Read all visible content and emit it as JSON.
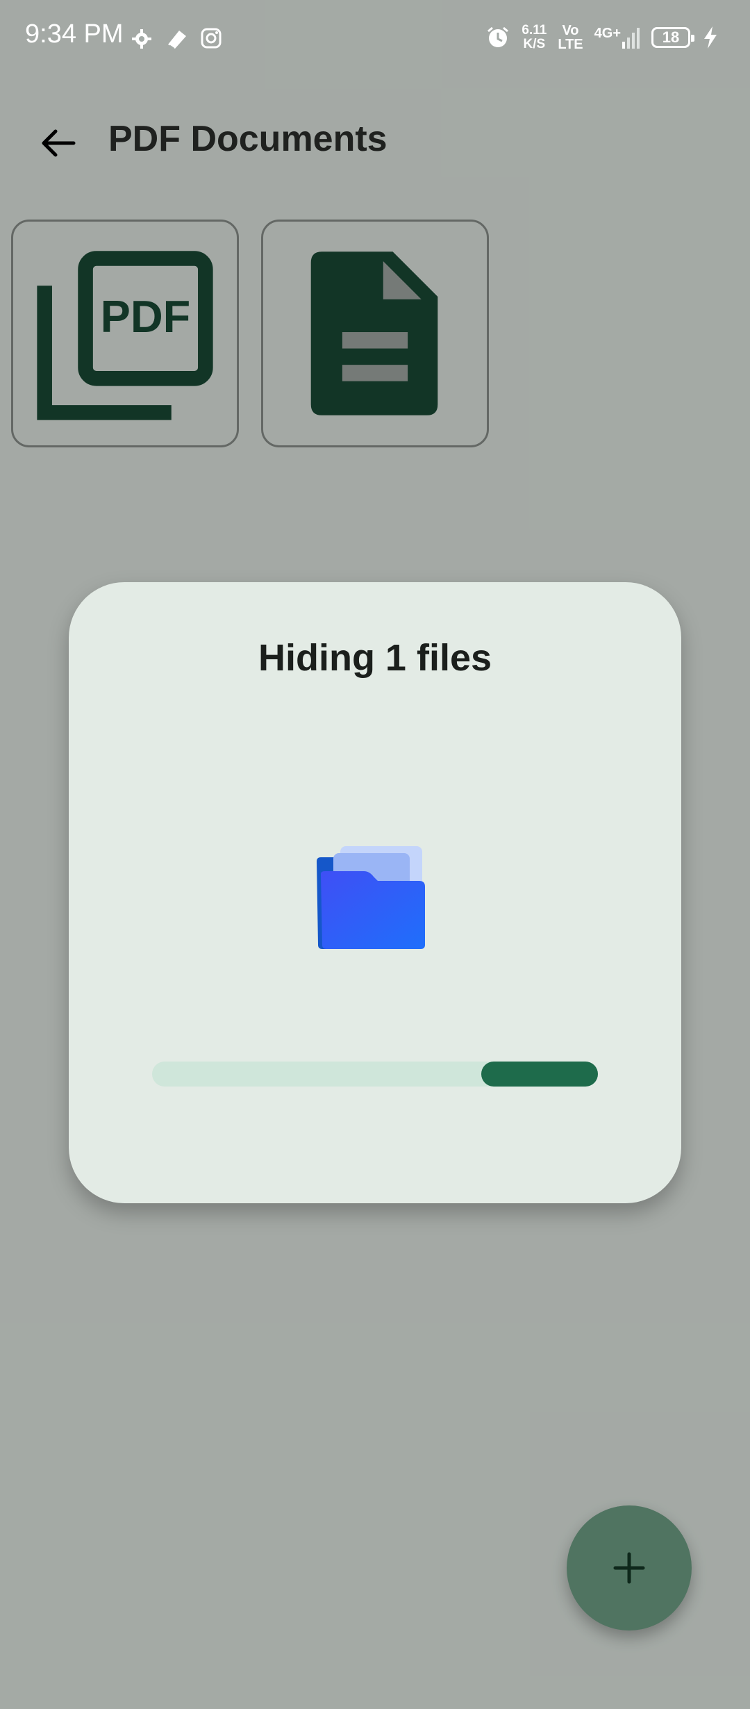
{
  "status_bar": {
    "time": "9:34 PM",
    "net_speed_value": "6.11",
    "net_speed_unit": "K/S",
    "volte_top": "Vo",
    "volte_bottom": "LTE",
    "network": "4G+",
    "battery_level": "18",
    "left_icons": [
      "settings-gear-icon",
      "cleaner-icon",
      "instagram-icon"
    ],
    "right_icons": [
      "alarm-icon",
      "signal-icon",
      "battery-icon",
      "charging-icon"
    ]
  },
  "app_bar": {
    "title": "PDF Documents",
    "back_icon": "arrow-back-icon"
  },
  "tiles": [
    {
      "icon": "pdf-collection-icon",
      "label_glyph": "PDF"
    },
    {
      "icon": "document-file-icon"
    }
  ],
  "dialog": {
    "title": "Hiding 1 files",
    "icon": "folder-icon",
    "progress": {
      "type": "indeterminate"
    }
  },
  "fab": {
    "icon": "plus-icon"
  },
  "colors": {
    "background": "#e3ebe5",
    "scrim": "#000000",
    "icon_green": "#1a4a35",
    "progress_track": "#cfe6da",
    "progress_indicator": "#1e6b4b",
    "fab": "#6fa187"
  }
}
